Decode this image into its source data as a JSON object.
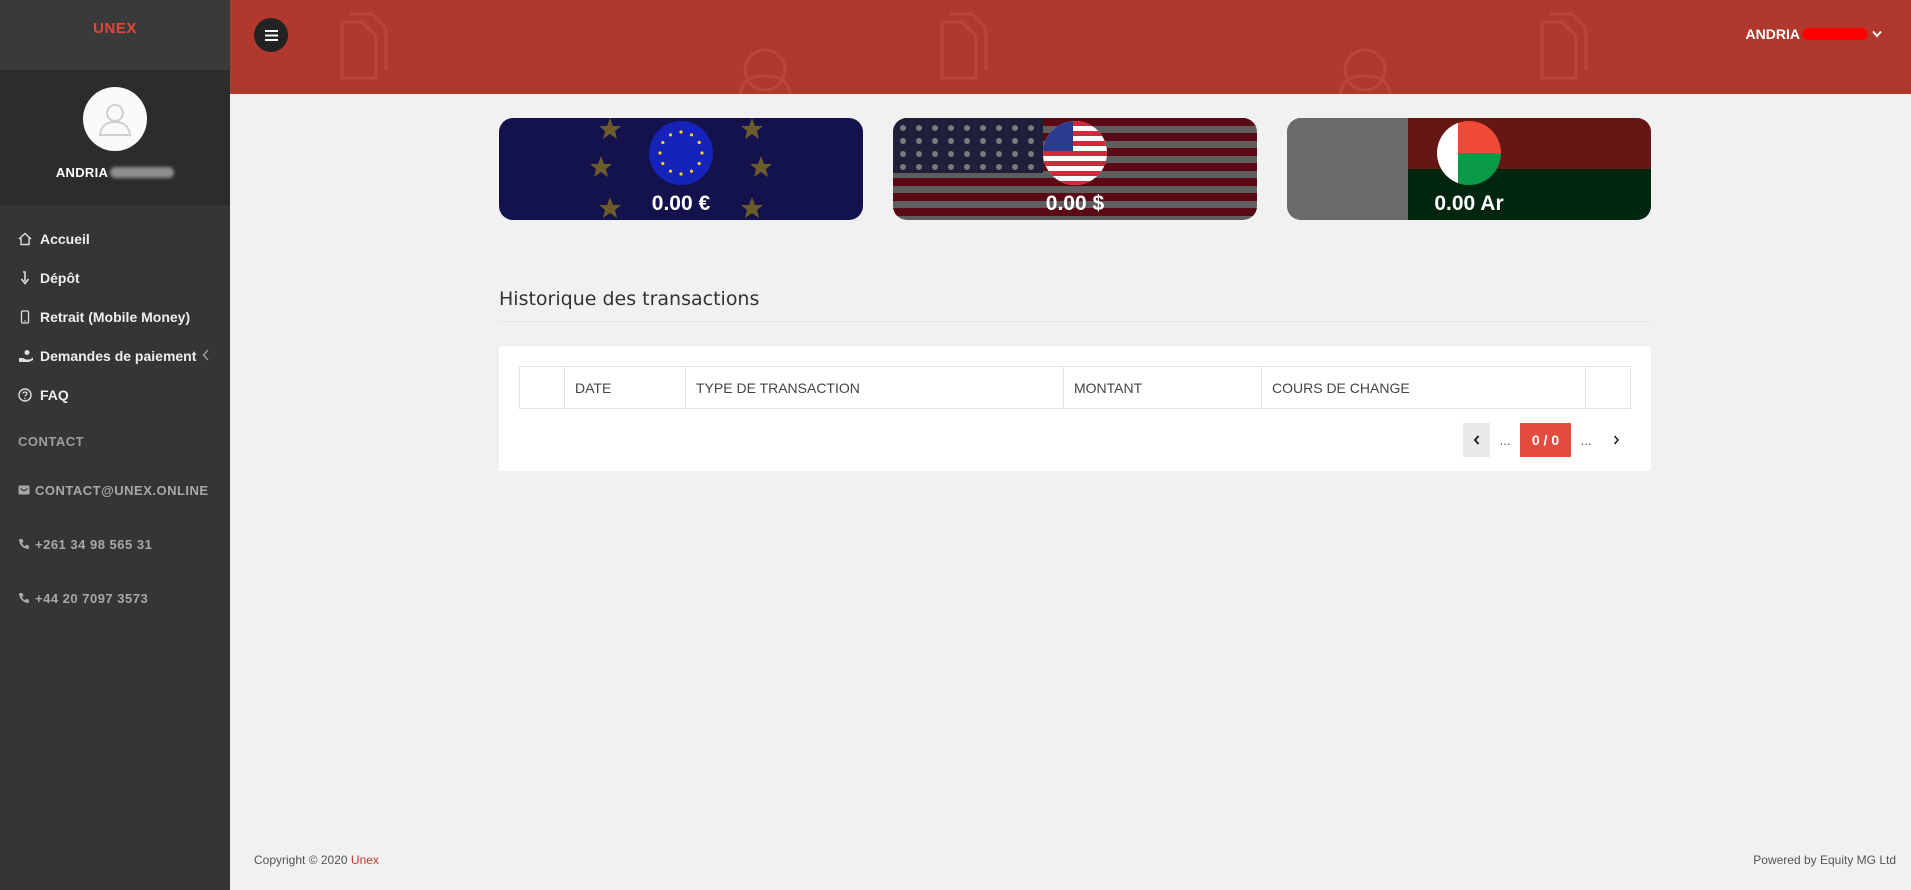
{
  "sidebar": {
    "brand": "UNEX",
    "user_name": "ANDRIA",
    "nav": [
      {
        "label": "Accueil",
        "icon": "home-icon"
      },
      {
        "label": "Dépôt",
        "icon": "arrow-down-icon"
      },
      {
        "label": "Retrait (Mobile Money)",
        "icon": "mobile-icon"
      },
      {
        "label": "Demandes de paiement",
        "icon": "hand-coin-icon"
      },
      {
        "label": "FAQ",
        "icon": "question-circle-icon"
      }
    ],
    "section_label": "CONTACT",
    "contacts": [
      {
        "label": "CONTACT@UNEX.ONLINE",
        "icon": "envelope-icon"
      },
      {
        "label": "+261 34 98 565 31",
        "icon": "phone-icon"
      },
      {
        "label": "+44 20 7097 3573",
        "icon": "phone-icon"
      }
    ]
  },
  "header": {
    "user_name": "ANDRIA",
    "accent": "#b0382d"
  },
  "balances": [
    {
      "amount": "0.00 €",
      "currency": "EUR",
      "flag": "eu-flag"
    },
    {
      "amount": "0.00 $",
      "currency": "USD",
      "flag": "us-flag"
    },
    {
      "amount": "0.00 Ar",
      "currency": "MGA",
      "flag": "madagascar-flag"
    }
  ],
  "history": {
    "title": "Historique des transactions",
    "columns": [
      "",
      "DATE",
      "TYPE DE TRANSACTION",
      "MONTANT",
      "COURS DE CHANGE",
      ""
    ],
    "pager": {
      "prev_dots": "...",
      "current": "0 / 0",
      "next_dots": "..."
    }
  },
  "footer": {
    "copyright": "Copyright © 2020 ",
    "brand": "Unex",
    "powered": "Powered by Equity MG Ltd"
  }
}
